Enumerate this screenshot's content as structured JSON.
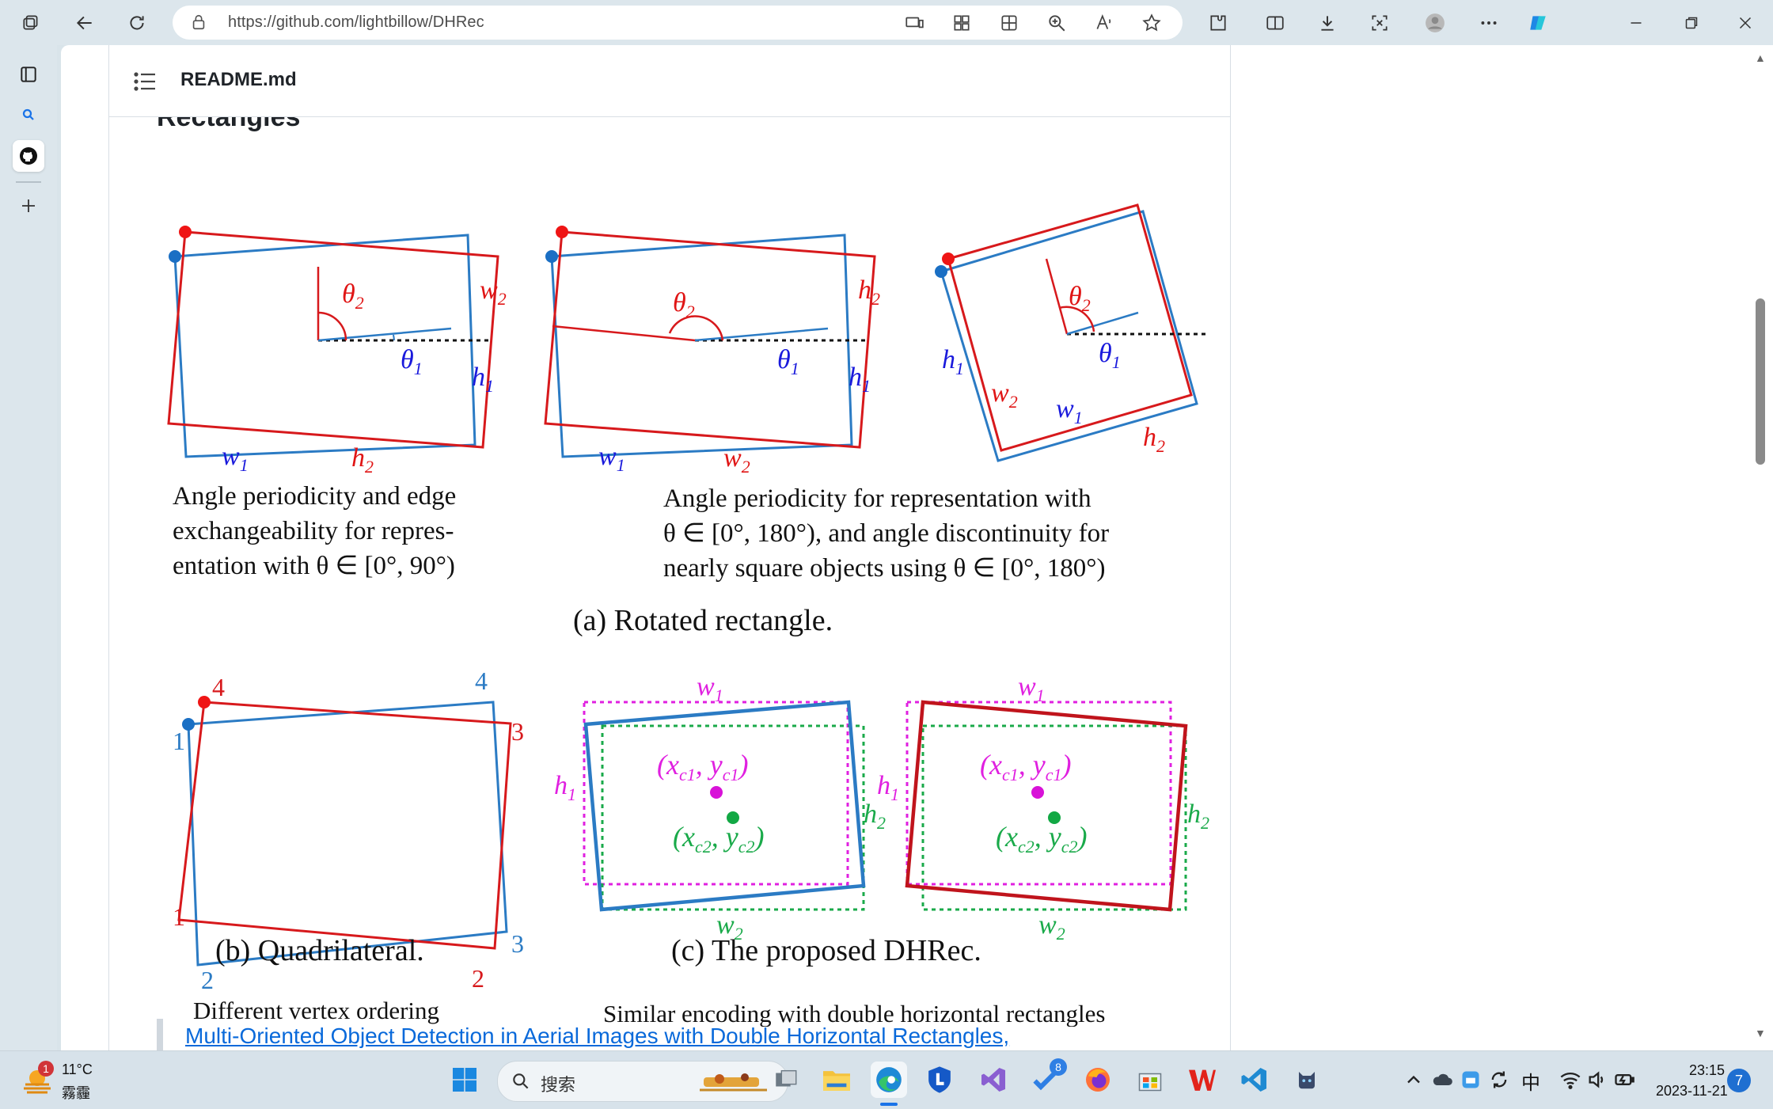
{
  "browser": {
    "url": "https://github.com/lightbillow/DHRec",
    "colors": {
      "edge_accent": "#1a73e8"
    }
  },
  "readme": {
    "title": "README.md",
    "section_heading": "Rectangles",
    "figure": {
      "panel_a_left_caption": [
        "Angle periodicity and edge",
        "exchangeability for repres-",
        "entation with  θ ∈ [0°, 90°)"
      ],
      "panel_a_right_caption": [
        "Angle periodicity for representation with",
        "θ ∈ [0°, 180°), and angle discontinuity for",
        "nearly square objects using  θ ∈ [0°, 180°)"
      ],
      "panel_a_title": "(a) Rotated rectangle.",
      "panel_b_caption": "Different vertex ordering",
      "panel_b_title": "(b) Quadrilateral.",
      "panel_c_caption": "Similar encoding with double horizontal rectangles",
      "panel_c_title": "(c) The proposed DHRec.",
      "vertex_labels": {
        "one": "1",
        "two": "2",
        "three": "3",
        "four": "4"
      },
      "c_labels": {
        "center1": "(x",
        "center1_sub": "c1",
        "center1_y": ", y",
        "center1_close": ")",
        "center2": "(x",
        "center2_sub": "c2",
        "center2_close": ")"
      },
      "colors": {
        "red": "#d7191c",
        "blue": "#2b7bc4",
        "magenta": "#e020e0",
        "green": "#1aaa4a",
        "label_blue": "#1a1adc",
        "label_red": "#e01515"
      }
    },
    "paper_link": "Multi-Oriented Object Detection in Aerial Images with Double Horizontal Rectangles,"
  },
  "taskbar": {
    "weather_temp": "11°C",
    "weather_desc": "霧霾",
    "weather_badge": "1",
    "search_placeholder": "搜索",
    "todo_badge": "8",
    "ime": "中",
    "time": "23:15",
    "date": "2023-11-21",
    "notification_count": "7"
  }
}
